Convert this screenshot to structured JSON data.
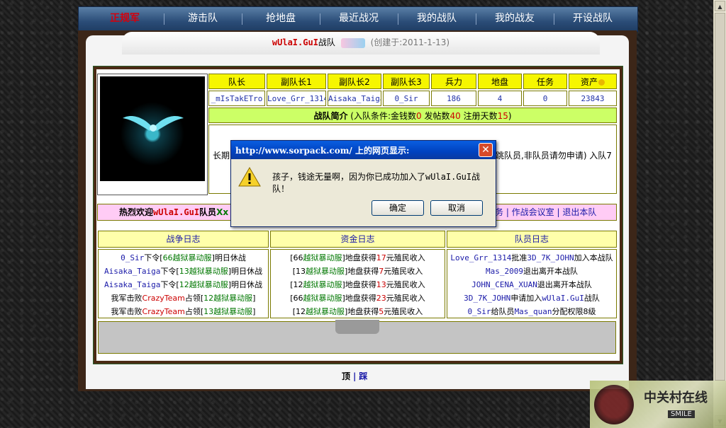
{
  "nav": {
    "items": [
      "正规军",
      "游击队",
      "抢地盘",
      "最近战况",
      "我的战队",
      "我的战友",
      "开设战队"
    ],
    "active_index": 0
  },
  "team": {
    "name": "wUlaI.GuI",
    "label": "战队",
    "created": "(创建于:2011-1-13)"
  },
  "stats": {
    "headers": [
      "队长",
      "副队长1",
      "副队长2",
      "副队长3",
      "兵力",
      "地盘",
      "任务",
      "资产"
    ],
    "values": [
      "_mIsTakETro",
      "Love_Grr_1314",
      "Aisaka_Taiga",
      "0_Sir",
      "186",
      "4",
      "0",
      "23843"
    ]
  },
  "intro": {
    "title": "战队简介",
    "cond_prefix": "(入队条件:金钱数",
    "money": "0",
    "posts_label": " 发帖数",
    "posts": "40",
    "days_label": " 注册天数",
    "days": "15",
    "cond_suffix": ")",
    "body_left": "长期",
    "body_right": "跳队员,非队员请勿申请) 入队7"
  },
  "welcome": {
    "prefix": "热烈欢迎",
    "name": "wUlaI.GuI",
    "suffix": "队员",
    "tail": "Xx",
    "links": "务 | 作战会议室 | 退出本队"
  },
  "logs": {
    "war": {
      "title": "战争日志",
      "rows": [
        [
          {
            "t": "0_Sir",
            "c": "p"
          },
          {
            "t": "下令[",
            "c": "blk"
          },
          {
            "t": "66越狱暴动服",
            "c": "srv"
          },
          {
            "t": "]明日休战",
            "c": "blk"
          }
        ],
        [
          {
            "t": "Aisaka_Taiga",
            "c": "p"
          },
          {
            "t": "下令[",
            "c": "blk"
          },
          {
            "t": "13越狱暴动服",
            "c": "srv"
          },
          {
            "t": "]明日休战",
            "c": "blk"
          }
        ],
        [
          {
            "t": "Aisaka_Taiga",
            "c": "p"
          },
          {
            "t": "下令[",
            "c": "blk"
          },
          {
            "t": "12越狱暴动服",
            "c": "srv"
          },
          {
            "t": "]明日休战",
            "c": "blk"
          }
        ],
        [
          {
            "t": "我军击败",
            "c": "blk"
          },
          {
            "t": "CrazyTeam",
            "c": "red"
          },
          {
            "t": "占领[",
            "c": "blk"
          },
          {
            "t": "12越狱暴动服",
            "c": "srv"
          },
          {
            "t": "]",
            "c": "blk"
          }
        ],
        [
          {
            "t": "我军击败",
            "c": "blk"
          },
          {
            "t": "CrazyTeam",
            "c": "red"
          },
          {
            "t": "占领[",
            "c": "blk"
          },
          {
            "t": "13越狱暴动服",
            "c": "srv"
          },
          {
            "t": "]",
            "c": "blk"
          }
        ]
      ]
    },
    "funds": {
      "title": "资金日志",
      "rows": [
        [
          {
            "t": "[66",
            "c": "blk"
          },
          {
            "t": "越狱暴动服",
            "c": "srv"
          },
          {
            "t": "]地盘获得",
            "c": "blk"
          },
          {
            "t": "17",
            "c": "red"
          },
          {
            "t": "元殖民收入",
            "c": "blk"
          }
        ],
        [
          {
            "t": "[13",
            "c": "blk"
          },
          {
            "t": "越狱暴动服",
            "c": "srv"
          },
          {
            "t": "]地盘获得",
            "c": "blk"
          },
          {
            "t": "7",
            "c": "red"
          },
          {
            "t": "元殖民收入",
            "c": "blk"
          }
        ],
        [
          {
            "t": "[12",
            "c": "blk"
          },
          {
            "t": "越狱暴动服",
            "c": "srv"
          },
          {
            "t": "]地盘获得",
            "c": "blk"
          },
          {
            "t": "13",
            "c": "red"
          },
          {
            "t": "元殖民收入",
            "c": "blk"
          }
        ],
        [
          {
            "t": "[66",
            "c": "blk"
          },
          {
            "t": "越狱暴动服",
            "c": "srv"
          },
          {
            "t": "]地盘获得",
            "c": "blk"
          },
          {
            "t": "23",
            "c": "red"
          },
          {
            "t": "元殖民收入",
            "c": "blk"
          }
        ],
        [
          {
            "t": "[12",
            "c": "blk"
          },
          {
            "t": "越狱暴动服",
            "c": "srv"
          },
          {
            "t": "]地盘获得",
            "c": "blk"
          },
          {
            "t": "5",
            "c": "red"
          },
          {
            "t": "元殖民收入",
            "c": "blk"
          }
        ]
      ]
    },
    "members": {
      "title": "队员日志",
      "rows": [
        [
          {
            "t": "Love_Grr_1314",
            "c": "p"
          },
          {
            "t": "批准",
            "c": "blk"
          },
          {
            "t": "3D_7K_JOHN",
            "c": "p"
          },
          {
            "t": "加入本战队",
            "c": "blk"
          }
        ],
        [
          {
            "t": "Mas_2009",
            "c": "p"
          },
          {
            "t": "退出离开本战队",
            "c": "blk"
          }
        ],
        [
          {
            "t": "JOHN_CENA_XUAN",
            "c": "p"
          },
          {
            "t": "退出离开本战队",
            "c": "blk"
          }
        ],
        [
          {
            "t": "3D_7K_JOHN",
            "c": "p"
          },
          {
            "t": "申请加入",
            "c": "blk"
          },
          {
            "t": "wUlaI.GuI",
            "c": "p"
          },
          {
            "t": "战队",
            "c": "blk"
          }
        ],
        [
          {
            "t": "0_Sir",
            "c": "p"
          },
          {
            "t": "给队员",
            "c": "blk"
          },
          {
            "t": "Mas_quan",
            "c": "p"
          },
          {
            "t": "分配权限8级",
            "c": "blk"
          }
        ]
      ]
    }
  },
  "footer": {
    "left": "顶",
    "sep": "|",
    "right": "踩"
  },
  "dialog": {
    "title": "http://www.sorpack.com/ 上的网页显示:",
    "message_pre": "孩子，钱途无量啊，因为你已成功加入了",
    "message_name": "wUlaI.GuI",
    "message_post": "战队！",
    "ok": "确定",
    "cancel": "取消",
    "close": "✕"
  },
  "watermark": {
    "text": "中关村在线",
    "badge": "SMILE"
  }
}
